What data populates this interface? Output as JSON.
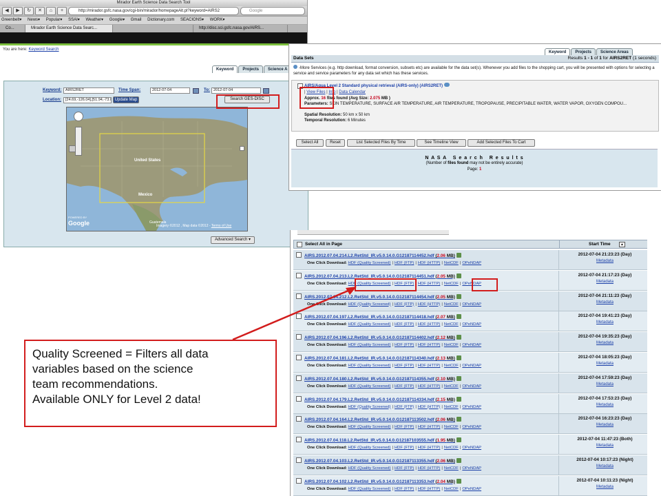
{
  "win1": {
    "window_title": "Mirador Earth Science Data Search Tool",
    "url": "http://mirador.gsfc.nasa.gov/cgi-bin/mirador/homepageAlt.pl?keyword=AIRS2",
    "search_placeholder": "Google",
    "bookmarks": [
      "Greenbelt▾",
      "News▾",
      "Popular▾",
      "SSAI▾",
      "Weather▾",
      "Google▾",
      "Gmail",
      "Dictionary.com",
      "SEACIONS▾",
      "WORK▾"
    ],
    "browser_tabs": [
      "Co...",
      "Mirador Earth Science Data Searc...",
      "",
      "http://disc.sci.gsfc.nasa.gov/AIRS..."
    ],
    "you_are_here": "You are here:",
    "breadcrumb_link": "Keyword Search",
    "tabs": [
      "Keyword",
      "Projects",
      "Science A"
    ],
    "keyword_label": "Keyword:",
    "keyword_value": "AIRS2RET",
    "timespan_label": "Time Span:",
    "time_from": "2012-07-04",
    "to_label": "To:",
    "time_to": "2012-07-04",
    "location_label": "Location:",
    "location_value": "[24.69,-126.04],[51.94,-73.0",
    "update_map": "Update Map",
    "search_button": "Search GES-DISC",
    "map_labels": {
      "us": "United States",
      "mexico": "Mexico",
      "google": "Google",
      "powered": "POWERED BY",
      "imagery": "Imagery ©2012 , Map data ©2012 -",
      "terms": "Terms of Use",
      "guatemala": "Guatemala"
    },
    "advanced_search": "Advanced Search"
  },
  "win2": {
    "tabs": [
      "Keyword",
      "Projects",
      "Science Areas"
    ],
    "header_title": "Data Sets",
    "results": "Results",
    "results_range": "1 - 1",
    "results_of": "of",
    "results_count": "1",
    "results_for": "for",
    "results_term": "AIRS2RET",
    "results_time": "(1 seconds)",
    "more_services": "-More Services (e.g. http download, format conversion, subsets etc) are available for the data set(s). Whenever you add files to the shopping cart, you will be presented with options for selecting a service and service parameters for any data set which has these services.",
    "dataset_title": "AIRS/Aqua Level 2 Standard physical retrieval (AIRS-only) (AIRS2RET)",
    "view_files": "View Files",
    "info": "Info",
    "data_calendar": "Data Calendar",
    "approx_label": "Approx.",
    "approx_count": "16",
    "approx_text": "files found (Avg Size:",
    "avg_size": "2.075",
    "avg_unit": "MB )",
    "parameters_label": "Parameters:",
    "parameters": "SKIN TEMPERATURE, SURFACE AIR TEMPERATURE, AIR TEMPERATURE, TROPOPAUSE, PRECIPITABLE WATER, WATER VAPOR, OXYGEN COMPOU...",
    "spatial_label": "Spatial Resolution:",
    "spatial": "50 km x 50 km",
    "temporal_label": "Temporal Resolution:",
    "temporal": "6 Minutes",
    "buttons": [
      "Select All",
      "Reset",
      "List Selected Files By Time",
      "See Timeline View",
      "Add Selected Files To Cart"
    ],
    "nasa_title": "N A S A   S e a r c h   R e s u l t s",
    "nasa_note_pre": "(Number of",
    "nasa_note_bold": "files found",
    "nasa_note_post": "may not be entirely accurate)",
    "page_label": "Page:",
    "page_num": "1"
  },
  "win3": {
    "select_all": "Select All in Page",
    "start_time": "Start Time",
    "one_click": "One Click Download:",
    "links": [
      "HDF (Quality Screened)",
      "HDF (FTP)",
      "HDF (HTTP)",
      "NetCDF",
      "OPeNDAP"
    ],
    "metadata": "Metadata",
    "rows": [
      {
        "file": "AIRS.2012.07.04.214.L2.RetStd_IR.v5.0.14.0.G12187114452.hdf",
        "size": "2.06",
        "time": "2012-07-04 21:23:23 (Day)"
      },
      {
        "file": "AIRS.2012.07.04.213.L2.RetStd_IR.v5.0.14.0.G12187114451.hdf",
        "size": "2.05",
        "time": "2012-07-04 21:17:23 (Day)"
      },
      {
        "file": "AIRS.2012.07.04.212.L2.RetStd_IR.v5.0.14.0.G12187114454.hdf",
        "size": "2.05",
        "time": "2012-07-04 21:11:23 (Day)"
      },
      {
        "file": "AIRS.2012.07.04.197.L2.RetStd_IR.v5.0.14.0.G12187114418.hdf",
        "size": "2.07",
        "time": "2012-07-04 19:41:23 (Day)"
      },
      {
        "file": "AIRS.2012.07.04.196.L2.RetStd_IR.v5.0.14.0.G12187114402.hdf",
        "size": "2.12",
        "time": "2012-07-04 19:35:23 (Day)"
      },
      {
        "file": "AIRS.2012.07.04.181.L2.RetStd_IR.v5.0.14.0.G12187114340.hdf",
        "size": "2.13",
        "time": "2012-07-04 18:05:23 (Day)"
      },
      {
        "file": "AIRS.2012.07.04.180.L2.RetStd_IR.v5.0.14.0.G12187114355.hdf",
        "size": "2.10",
        "time": "2012-07-04 17:59:23 (Day)"
      },
      {
        "file": "AIRS.2012.07.04.179.L2.RetStd_IR.v5.0.14.0.G12187114334.hdf",
        "size": "2.15",
        "time": "2012-07-04 17:53:23 (Day)"
      },
      {
        "file": "AIRS.2012.07.04.164.L2.RetStd_IR.v5.0.14.0.G12187113502.hdf",
        "size": "2.06",
        "time": "2012-07-04 16:23:23 (Day)"
      },
      {
        "file": "AIRS.2012.07.04.118.L2.RetStd_IR.v5.0.14.0.G12187103555.hdf",
        "size": "1.95",
        "time": "2012-07-04 11:47:23 (Both)"
      },
      {
        "file": "AIRS.2012.07.04.103.L2.RetStd_IR.v5.0.14.0.G12187113355.hdf",
        "size": "2.06",
        "time": "2012-07-04 10:17:23 (Night)"
      },
      {
        "file": "AIRS.2012.07.04.102.L2.RetStd_IR.v5.0.14.0.G12187113353.hdf",
        "size": "2.04",
        "time": "2012-07-04 10:11:23 (Night)"
      }
    ],
    "mb": "MB)"
  },
  "callout": {
    "lines": [
      "Quality Screened = Filters all data",
      "variables based on the science",
      "team recommendations.",
      "Available ONLY for Level 2 data!"
    ]
  },
  "colors": {
    "annotation_red": "#d21c1c",
    "link_blue": "#1a3fa8",
    "size_red": "#c4001a"
  }
}
